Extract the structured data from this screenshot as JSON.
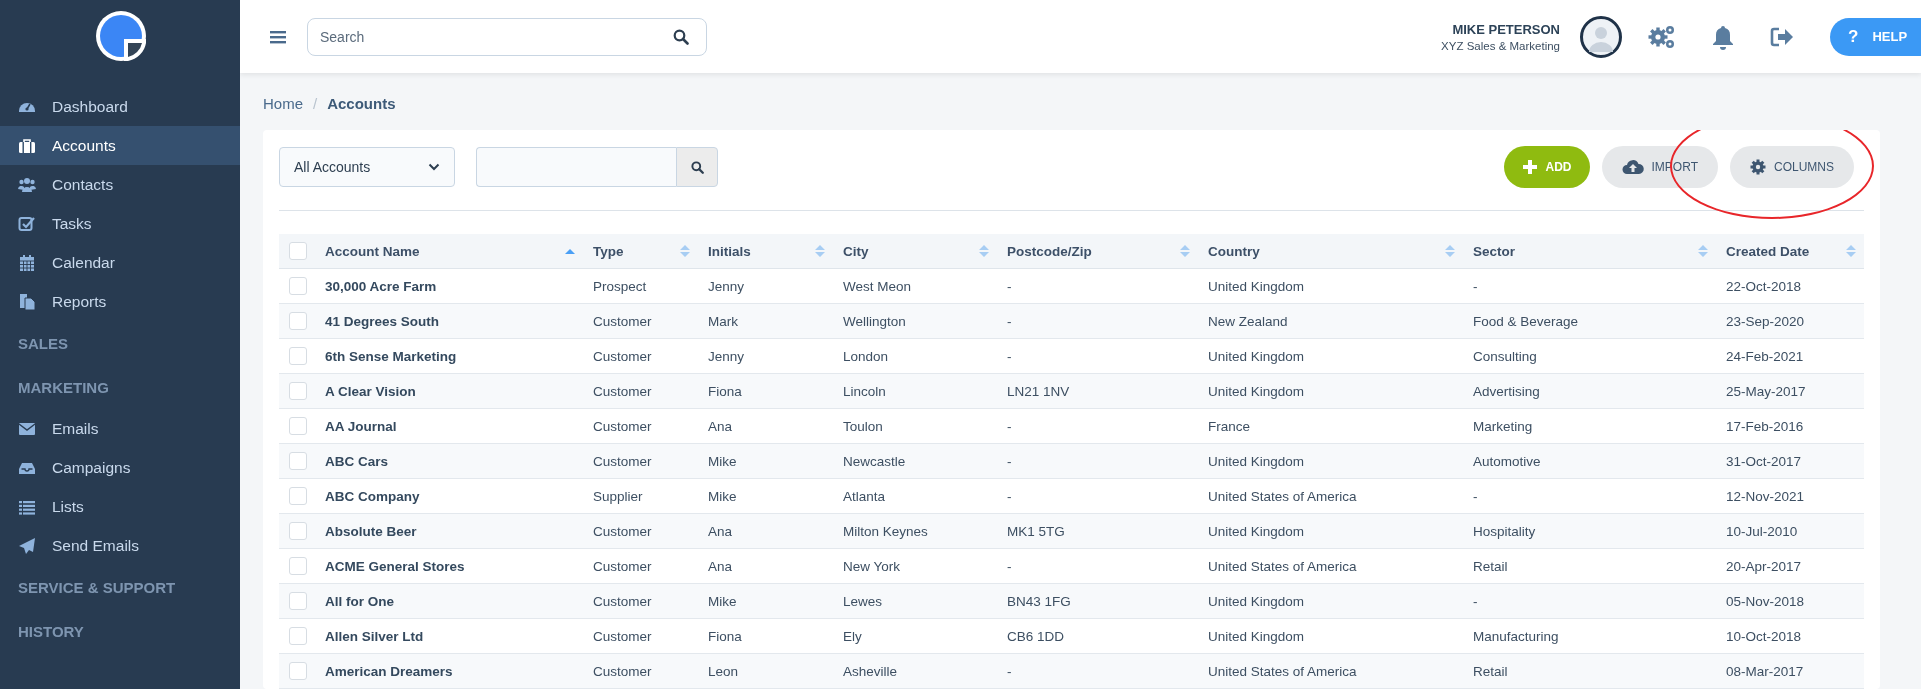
{
  "sidebar": {
    "items": [
      {
        "kind": "link",
        "label": "Dashboard",
        "selected": false
      },
      {
        "kind": "link",
        "label": "Accounts",
        "selected": true
      },
      {
        "kind": "link",
        "label": "Contacts",
        "selected": false
      },
      {
        "kind": "link",
        "label": "Tasks",
        "selected": false
      },
      {
        "kind": "link",
        "label": "Calendar",
        "selected": false
      },
      {
        "kind": "link",
        "label": "Reports",
        "selected": false
      },
      {
        "kind": "section",
        "label": "SALES"
      },
      {
        "kind": "section",
        "label": "MARKETING"
      },
      {
        "kind": "link",
        "label": "Emails",
        "selected": false
      },
      {
        "kind": "link",
        "label": "Campaigns",
        "selected": false
      },
      {
        "kind": "link",
        "label": "Lists",
        "selected": false
      },
      {
        "kind": "link",
        "label": "Send Emails",
        "selected": false
      },
      {
        "kind": "section",
        "label": "SERVICE & SUPPORT"
      },
      {
        "kind": "section",
        "label": "HISTORY"
      }
    ]
  },
  "topbar": {
    "search": {
      "placeholder": "Search"
    },
    "user": {
      "name": "MIKE PETERSON",
      "company": "XYZ Sales & Marketing"
    },
    "help_icon": "?",
    "help": "HELP"
  },
  "breadcrumb": {
    "home": "Home",
    "separator": "/",
    "current": "Accounts"
  },
  "toolbar": {
    "filter": "All Accounts",
    "buttons": [
      {
        "kind": "add",
        "label": "ADD",
        "circled": false
      },
      {
        "kind": "import",
        "label": "IMPORT",
        "circled": false
      },
      {
        "kind": "columns",
        "label": "COLUMNS",
        "circled": true
      }
    ]
  },
  "table": {
    "all_checked": false,
    "columns": [
      {
        "label": "Account Name",
        "sorted": true
      },
      {
        "label": "Type",
        "sorted": false
      },
      {
        "label": "Initials",
        "sorted": false
      },
      {
        "label": "City",
        "sorted": false
      },
      {
        "label": "Postcode/Zip",
        "sorted": false
      },
      {
        "label": "Country",
        "sorted": false
      },
      {
        "label": "Sector",
        "sorted": false
      },
      {
        "label": "Created Date",
        "sorted": false
      }
    ],
    "rows": [
      {
        "checked": false,
        "cells": [
          "30,000 Acre Farm",
          "Prospect",
          "Jenny",
          "West Meon",
          "-",
          "United Kingdom",
          "-",
          "22-Oct-2018"
        ]
      },
      {
        "checked": false,
        "cells": [
          "41 Degrees South",
          "Customer",
          "Mark",
          "Wellington",
          "-",
          "New Zealand",
          "Food & Beverage",
          "23-Sep-2020"
        ]
      },
      {
        "checked": false,
        "cells": [
          "6th Sense Marketing",
          "Customer",
          "Jenny",
          "London",
          "-",
          "United Kingdom",
          "Consulting",
          "24-Feb-2021"
        ]
      },
      {
        "checked": false,
        "cells": [
          "A Clear Vision",
          "Customer",
          "Fiona",
          "Lincoln",
          "LN21 1NV",
          "United Kingdom",
          "Advertising",
          "25-May-2017"
        ]
      },
      {
        "checked": false,
        "cells": [
          "AA Journal",
          "Customer",
          "Ana",
          "Toulon",
          "-",
          "France",
          "Marketing",
          "17-Feb-2016"
        ]
      },
      {
        "checked": false,
        "cells": [
          "ABC Cars",
          "Customer",
          "Mike",
          "Newcastle",
          "-",
          "United Kingdom",
          "Automotive",
          "31-Oct-2017"
        ]
      },
      {
        "checked": false,
        "cells": [
          "ABC Company",
          "Supplier",
          "Mike",
          "Atlanta",
          "-",
          "United States of America",
          "-",
          "12-Nov-2021"
        ]
      },
      {
        "checked": false,
        "cells": [
          "Absolute Beer",
          "Customer",
          "Ana",
          "Milton Keynes",
          "MK1 5TG",
          "United Kingdom",
          "Hospitality",
          "10-Jul-2010"
        ]
      },
      {
        "checked": false,
        "cells": [
          "ACME General Stores",
          "Customer",
          "Ana",
          "New York",
          "-",
          "United States of America",
          "Retail",
          "20-Apr-2017"
        ]
      },
      {
        "checked": false,
        "cells": [
          "All for One",
          "Customer",
          "Mike",
          "Lewes",
          "BN43 1FG",
          "United Kingdom",
          "-",
          "05-Nov-2018"
        ]
      },
      {
        "checked": false,
        "cells": [
          "Allen Silver Ltd",
          "Customer",
          "Fiona",
          "Ely",
          "CB6 1DD",
          "United Kingdom",
          "Manufacturing",
          "10-Oct-2018"
        ]
      },
      {
        "checked": false,
        "cells": [
          "American Dreamers",
          "Customer",
          "Leon",
          "Asheville",
          "-",
          "United States of America",
          "Retail",
          "08-Mar-2017"
        ]
      }
    ]
  }
}
